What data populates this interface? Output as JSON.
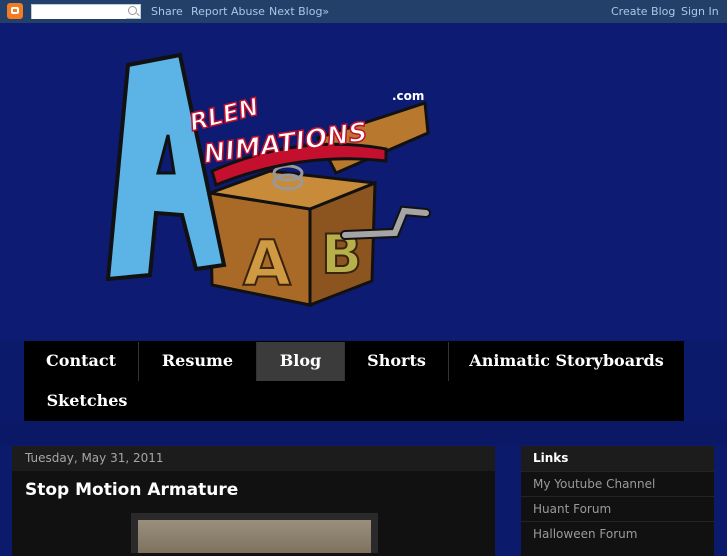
{
  "navbar": {
    "search_placeholder": "",
    "share": "Share",
    "report_abuse": "Report Abuse",
    "next_blog": "Next Blog»",
    "create_blog": "Create Blog",
    "sign_in": "Sign In"
  },
  "header": {
    "logo_text_letter": "A",
    "logo_text_rlen": "RLEN",
    "logo_text_nimations": "NIMATIONS",
    "logo_text_com": ".com",
    "block_letter_a": "A",
    "block_letter_b": "B"
  },
  "menu": {
    "tabs": [
      "Contact",
      "Resume",
      "Blog",
      "Shorts",
      "Animatic Storyboards",
      "Sketches"
    ],
    "active": "Blog"
  },
  "post": {
    "date": "Tuesday, May 31, 2011",
    "title": "Stop Motion Armature"
  },
  "sidebar": {
    "title": "Links",
    "items": [
      "My Youtube Channel",
      "Huant Forum",
      "Halloween Forum"
    ]
  },
  "colors": {
    "background": "#0c1a6b",
    "navbar": "#23406a",
    "logo_blue": "#5bb3e6",
    "logo_red": "#c4102e",
    "box_brown": "#8a5a22"
  }
}
